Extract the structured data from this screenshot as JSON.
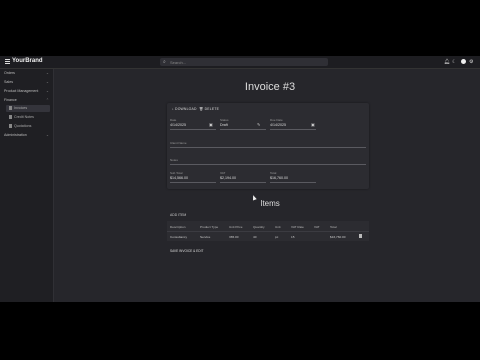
{
  "brand": "YourBrand",
  "search": {
    "placeholder": "Search..."
  },
  "sidebar": {
    "items": [
      {
        "label": "Orders"
      },
      {
        "label": "Sales"
      },
      {
        "label": "Product Management"
      },
      {
        "label": "Finance"
      },
      {
        "label": "Administration"
      }
    ],
    "sub_items": [
      {
        "label": "Invoices"
      },
      {
        "label": "Credit Notes"
      },
      {
        "label": "Quotations"
      }
    ]
  },
  "page": {
    "title": "Invoice #3",
    "items_title": "Items"
  },
  "toolbar": {
    "download": "DOWNLOAD",
    "delete": "DELETE"
  },
  "fields": {
    "date": {
      "label": "Date",
      "value": "4/14/2025"
    },
    "status": {
      "label": "Status",
      "value": "Draft"
    },
    "due_date": {
      "label": "Due Date",
      "value": "4/14/2025"
    },
    "client": {
      "label": "Client Name"
    },
    "notes": {
      "label": "Notes"
    },
    "sub_total": {
      "label": "Sub Total",
      "value": "$14,566.00"
    },
    "vat": {
      "label": "VAT",
      "value": "$2,194.00"
    },
    "total": {
      "label": "Total",
      "value": "$16,760.00"
    }
  },
  "items": {
    "add_label": "ADD ITEM",
    "columns": [
      "Description",
      "Product Type",
      "Unit Price",
      "Quantity",
      "Unit",
      "VAT Rate",
      "VAT",
      "Total"
    ],
    "rows": [
      [
        "Consultancy",
        "Service",
        "365.00",
        "40",
        "pc",
        "15",
        "",
        "$16,760.00"
      ]
    ]
  },
  "save_label": "SAVE INVOICE & EDIT"
}
